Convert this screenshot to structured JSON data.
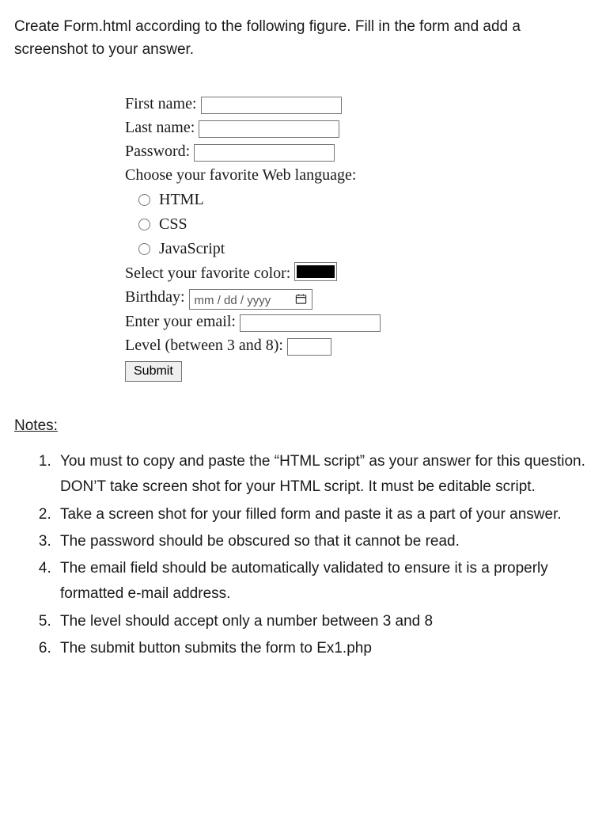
{
  "intro": "Create Form.html according to the following figure. Fill in the form and add a screenshot to your answer.",
  "form": {
    "first_name_label": "First name:",
    "last_name_label": "Last name:",
    "password_label": "Password:",
    "fav_lang_label": "Choose your favorite Web language:",
    "radios": {
      "html": "HTML",
      "css": "CSS",
      "js": "JavaScript"
    },
    "color_label": "Select your favorite color:",
    "color_value": "#000000",
    "birthday_label": "Birthday:",
    "birthday_placeholder": "mm / dd / yyyy",
    "email_label": "Enter your email:",
    "level_label": "Level (between 3 and 8):",
    "submit_label": "Submit"
  },
  "notes_heading": "Notes:",
  "notes": [
    "You must to copy and paste the “HTML script” as your answer for this question. DON’T take screen shot for your HTML script. It must be editable script.",
    "Take a screen shot for your filled form and paste it as a part of your answer.",
    "The password should be obscured so that it cannot be read.",
    "The email field should be automatically validated to ensure it is a properly formatted e-mail address.",
    "The level should accept only a number between 3 and 8",
    "The submit button submits the form to Ex1.php"
  ]
}
